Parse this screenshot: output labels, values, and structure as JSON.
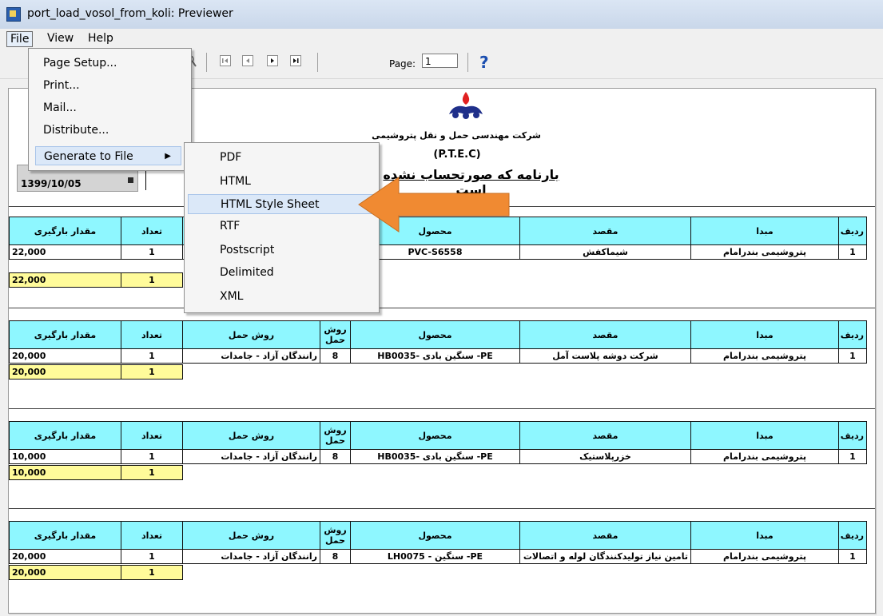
{
  "window": {
    "title": "port_load_vosol_from_koli: Previewer",
    "icon": "app-icon"
  },
  "menubar": {
    "items": [
      "File",
      "View",
      "Help"
    ]
  },
  "toolbar": {
    "page_label": "Page:",
    "page_value": "1",
    "help_glyph": "?"
  },
  "file_menu": {
    "items": [
      "Page Setup...",
      "Print...",
      "Mail...",
      "Distribute...",
      "Generate to File"
    ],
    "submenu_arrow": "▶"
  },
  "generate_submenu": {
    "items": [
      "PDF",
      "HTML",
      "HTML Style Sheet",
      "RTF",
      "Postscript",
      "Delimited",
      "XML"
    ],
    "highlighted": "HTML Style Sheet"
  },
  "report": {
    "company": "شرکت مهندسی حمل و نقل پتروشیمی",
    "abbreviation": "(P.T.E.C)",
    "title": "بارنامه که صورتحساب نشده است",
    "date": "1399/10/05",
    "headers": {
      "weight": "مقدار بارگیری",
      "count": "تعداد",
      "transport": "روش حمل",
      "transport_short": "روش حمل",
      "product": "محصول",
      "destination": "مقصد",
      "origin": "مبدا",
      "row": "ردیف"
    },
    "groups": [
      {
        "weight": "22,000",
        "count": "1",
        "transport": "",
        "code": "",
        "product": "PVC-S6558",
        "destination": "شیماکفش",
        "origin": "پتروشیمی بندرامام",
        "row": "1",
        "total_weight": "22,000",
        "total_count": "1"
      },
      {
        "weight": "20,000",
        "count": "1",
        "transport": "رانندگان آزاد - جامدات",
        "code": "8",
        "product": "PE- سنگین بادی -HB0035",
        "destination": "شرکت دوشه پلاست آمل",
        "origin": "پتروشیمی بندرامام",
        "row": "1",
        "total_weight": "20,000",
        "total_count": "1"
      },
      {
        "weight": "10,000",
        "count": "1",
        "transport": "رانندگان آزاد - جامدات",
        "code": "8",
        "product": "PE- سنگین بادی -HB0035",
        "destination": "خزرپلاستیک",
        "origin": "پتروشیمی بندرامام",
        "row": "1",
        "total_weight": "10,000",
        "total_count": "1"
      },
      {
        "weight": "20,000",
        "count": "1",
        "transport": "رانندگان آزاد - جامدات",
        "code": "8",
        "product": "PE- سنگین - LH0075",
        "destination": "تامین نیاز تولیدکنندگان لوله و اتصالات پی و",
        "origin": "پتروشیمی بندرامام",
        "row": "1",
        "total_weight": "20,000",
        "total_count": "1"
      }
    ]
  },
  "colors": {
    "header_cyan": "#8ef7ff",
    "total_yellow": "#fffb9a",
    "callout_orange": "#f08a32"
  }
}
